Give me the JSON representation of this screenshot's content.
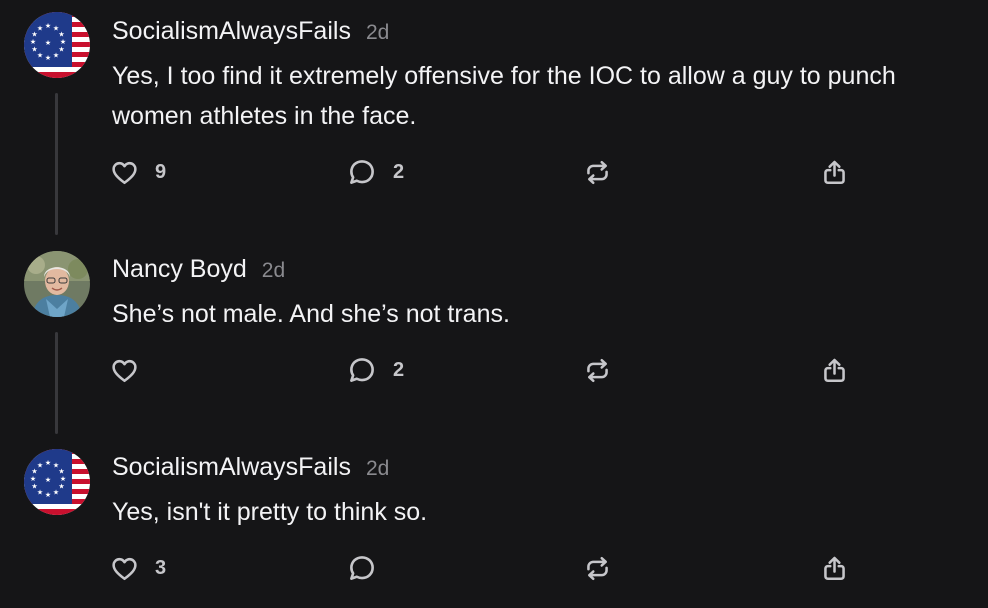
{
  "posts": [
    {
      "username": "SocialismAlwaysFails",
      "time": "2d",
      "avatar": "betsy-ross-flag-avatar",
      "text": "Yes, I too find it extremely offensive for the IOC to allow a guy to punch women athletes in the face.",
      "likes": "9",
      "replies": "2"
    },
    {
      "username": "Nancy Boyd",
      "time": "2d",
      "avatar": "photo-avatar",
      "text": "She’s not male. And she’s not trans.",
      "likes": "",
      "replies": "2"
    },
    {
      "username": "SocialismAlwaysFails",
      "time": "2d",
      "avatar": "betsy-ross-flag-avatar",
      "text": "Yes, isn't it pretty to think so.",
      "likes": "3",
      "replies": ""
    }
  ],
  "icons": {
    "like": "heart-icon",
    "reply": "comment-bubble-icon",
    "repost": "repost-icon",
    "share": "share-icon"
  },
  "colors": {
    "background": "#151517",
    "text": "#f3f3f5",
    "muted": "#8a8a8f",
    "icon": "#c6c6ca",
    "thread_line": "#38383c"
  }
}
